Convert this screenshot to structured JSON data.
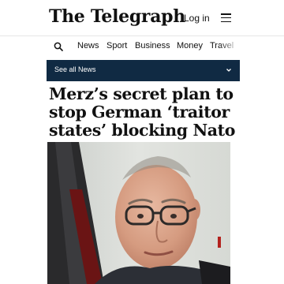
{
  "header": {
    "masthead": "The Telegraph",
    "login_label": "Log in"
  },
  "nav": {
    "items": [
      {
        "label": "News"
      },
      {
        "label": "Sport"
      },
      {
        "label": "Business"
      },
      {
        "label": "Money"
      },
      {
        "label": "Travel"
      }
    ]
  },
  "section_bar": {
    "label": "See all News"
  },
  "article": {
    "headline": "Merz’s secret plan to stop German ‘traitor states’ blocking Nato troops"
  },
  "colors": {
    "section_bar_bg": "#102a43",
    "text": "#111111"
  },
  "icons": {
    "search": "search-icon",
    "menu": "hamburger-menu-icon",
    "chevron": "chevron-down-icon"
  }
}
